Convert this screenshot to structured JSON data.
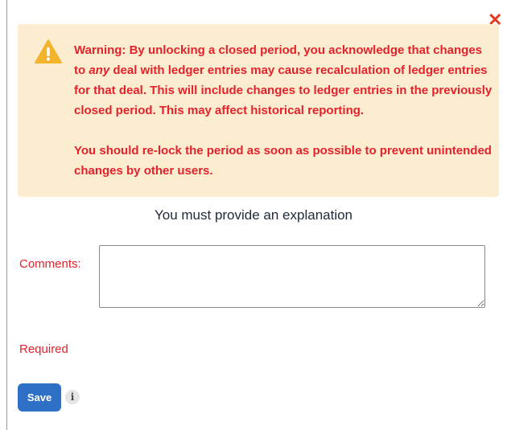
{
  "dialog": {
    "close_symbol": "✕",
    "warning": {
      "icon": "warning-triangle-icon",
      "paragraph1_before": "Warning: By unlocking a closed period, you acknowledge that changes to ",
      "paragraph1_emphasis": "any",
      "paragraph1_after": " deal with ledger entries may cause recalculation of ledger entries for that deal. This will include changes to ledger entries in the previously closed period. This may affect historical reporting.",
      "paragraph2": "You should re-lock the period as soon as possible to prevent unintended changes by other users."
    },
    "explanation_heading": "You must provide an explanation",
    "comments_label": "Comments:",
    "comments_value": "",
    "required_text": "Required",
    "save_label": "Save",
    "info_symbol": "i"
  },
  "colors": {
    "warning_bg": "#fcedd1",
    "warning_text": "#e4222b",
    "save_button": "#2e70c5",
    "close_icon": "#e5391f"
  }
}
